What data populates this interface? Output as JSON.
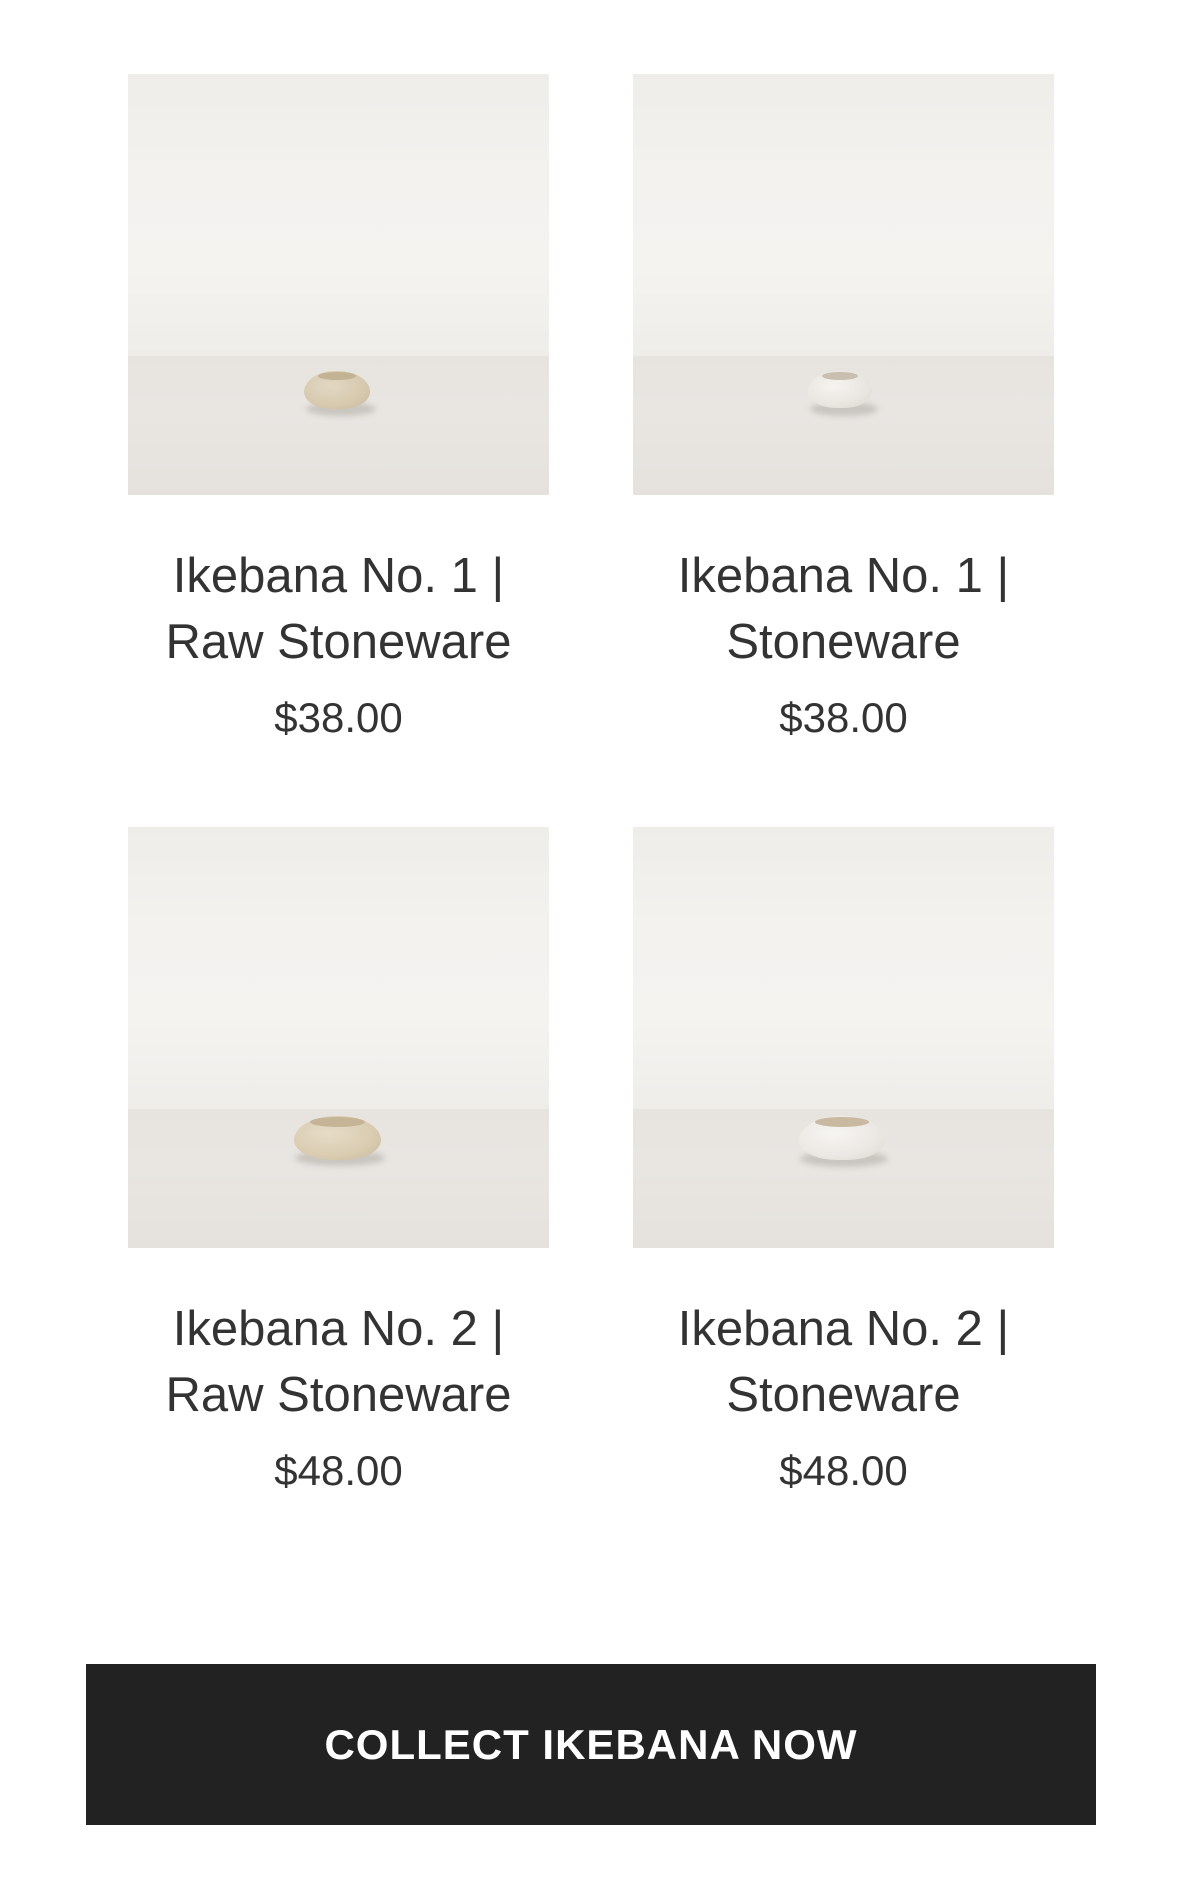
{
  "products": [
    {
      "title_line1": "Ikebana No. 1 |",
      "title_line2": "Raw Stoneware",
      "price": "$38.00",
      "image": {
        "subject": "small-raw-stoneware-bowl",
        "bowl_color": "#d8ccb4",
        "rim_color": "#c7b89c"
      }
    },
    {
      "title_line1": "Ikebana No. 1 |",
      "title_line2": "Stoneware",
      "price": "$38.00",
      "image": {
        "subject": "small-white-stoneware-bowl",
        "bowl_color": "#ebe8e2",
        "rim_color": "#cfc6b8"
      }
    },
    {
      "title_line1": "Ikebana No. 2 |",
      "title_line2": "Raw Stoneware",
      "price": "$48.00",
      "image": {
        "subject": "medium-raw-stoneware-bowl",
        "bowl_color": "#dccfb6",
        "rim_color": "#c9bca2"
      }
    },
    {
      "title_line1": "Ikebana No. 2 |",
      "title_line2": "Stoneware",
      "price": "$48.00",
      "image": {
        "subject": "medium-white-stoneware-bowl",
        "bowl_color": "#ece9e4",
        "rim_color": "#cdbfa9"
      }
    }
  ],
  "cta": {
    "label": "COLLECT IKEBANA NOW",
    "background": "#222222",
    "text_color": "#ffffff"
  },
  "colors": {
    "text": "#333333",
    "page_background": "#ffffff"
  }
}
